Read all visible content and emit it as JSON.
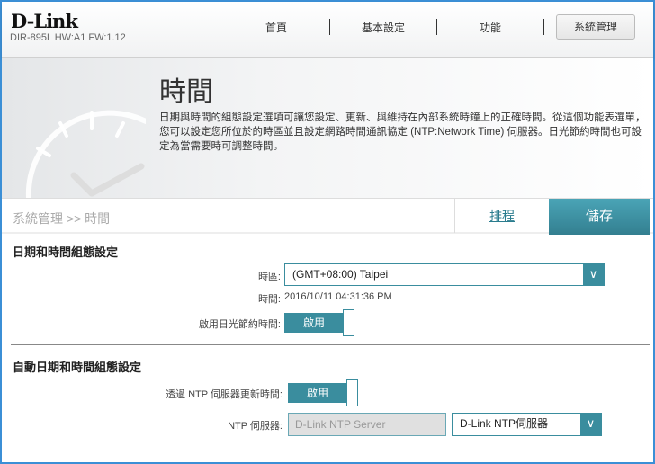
{
  "header": {
    "logo": "D-Link",
    "model": "DIR-895L HW:A1 FW:1.12",
    "nav": [
      "首頁",
      "基本設定",
      "功能",
      "系統管理"
    ]
  },
  "banner": {
    "title": "時間",
    "description": "日期與時間的組態設定選項可讓您設定、更新、與維持在內部系統時鐘上的正確時間。從這個功能表選單，您可以設定您所位於的時區並且設定網路時間通訊協定 (NTP:Network Time) 伺服器。日光節約時間也可設定為當需要時可調整時間。"
  },
  "breadcrumb": "系統管理 >> 時間",
  "actions": {
    "schedule": "排程",
    "save": "儲存"
  },
  "section1": {
    "title": "日期和時間組態設定",
    "timezone_label": "時區:",
    "timezone_value": "(GMT+08:00) Taipei",
    "time_label": "時間:",
    "time_value": "2016/10/11 04:31:36 PM",
    "dst_label": "啟用日光節約時間:",
    "dst_toggle": "啟用"
  },
  "section2": {
    "title": "自動日期和時間組態設定",
    "ntp_update_label": "透過 NTP 伺服器更新時間:",
    "ntp_toggle": "啟用",
    "ntp_server_label": "NTP 伺服器:",
    "ntp_server_input": "D-Link NTP Server",
    "ntp_server_select": "D-Link NTP伺服器"
  },
  "colors": {
    "accent": "#3a8d9e"
  }
}
